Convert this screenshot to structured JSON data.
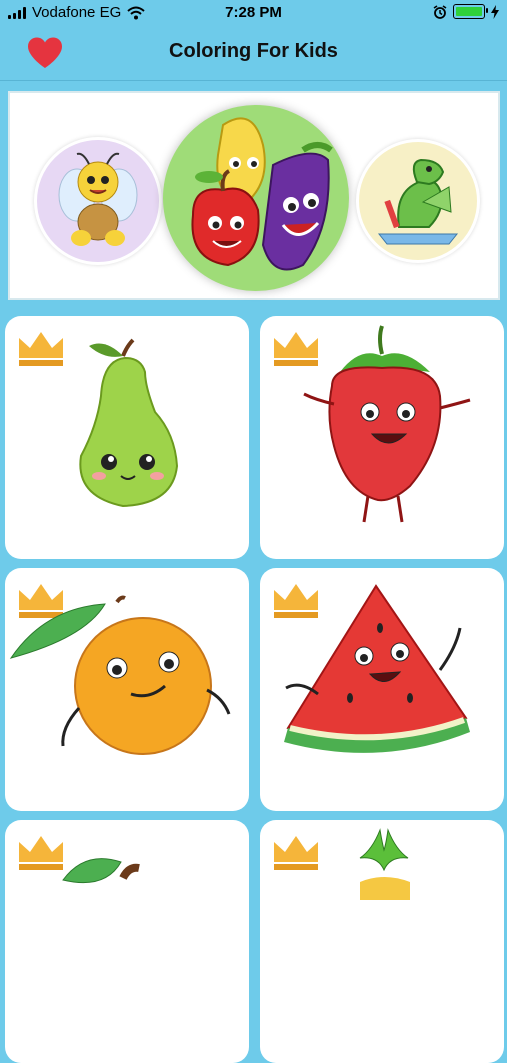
{
  "status": {
    "carrier": "Vodafone EG",
    "time": "7:28 PM"
  },
  "header": {
    "title": "Coloring For Kids",
    "favorites_icon": "heart-icon"
  },
  "banner": {
    "categories": [
      {
        "name": "bee-category-icon"
      },
      {
        "name": "fruits-category-icon"
      },
      {
        "name": "dragon-category-icon"
      }
    ]
  },
  "grid": {
    "items": [
      {
        "icon": "pear-icon",
        "premium": true
      },
      {
        "icon": "strawberry-icon",
        "premium": true
      },
      {
        "icon": "orange-icon",
        "premium": true
      },
      {
        "icon": "watermelon-icon",
        "premium": true
      },
      {
        "icon": "cherry-icon",
        "premium": true
      },
      {
        "icon": "pineapple-icon",
        "premium": true
      }
    ]
  },
  "colors": {
    "background": "#6ecbea",
    "heart": "#e5343f",
    "crown": "#f5b53a"
  }
}
